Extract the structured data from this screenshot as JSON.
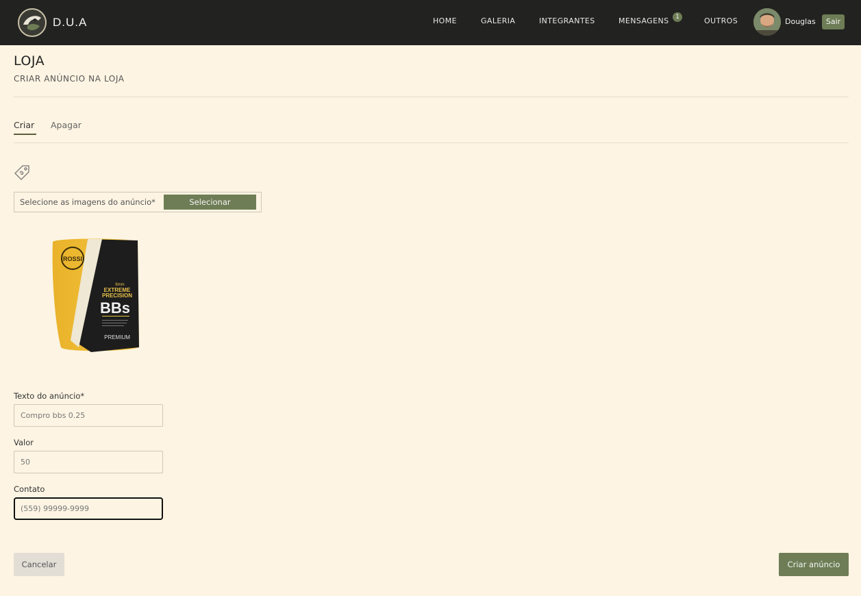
{
  "nav": {
    "brand": "D.U.A",
    "items": [
      {
        "label": "HOME"
      },
      {
        "label": "GALERIA"
      },
      {
        "label": "INTEGRANTES"
      },
      {
        "label": "MENSAGENS"
      },
      {
        "label": "OUTROS"
      }
    ],
    "messages_badge": "1",
    "user_name": "Douglas",
    "logout_label": "Sair"
  },
  "header": {
    "title": "LOJA",
    "subtitle": "CRIAR ANÚNCIO NA LOJA"
  },
  "tabs": [
    {
      "label": "Criar",
      "active": true
    },
    {
      "label": "Apagar",
      "active": false
    }
  ],
  "upload": {
    "label": "Selecione as imagens do anúncio*",
    "button_label": "Selecionar"
  },
  "product_image": {
    "brand_text": "ROSSI",
    "caliber": "6mm",
    "line1": "EXTREME",
    "line2": "PRECISION",
    "big_text": "BBs",
    "grade": "PREMIUM"
  },
  "form": {
    "text_label": "Texto do anúncio*",
    "text_placeholder": "Compro bbs 0.25",
    "value_label": "Valor",
    "value_placeholder": "50",
    "contact_label": "Contato",
    "contact_placeholder": "(559) 99999-9999"
  },
  "actions": {
    "cancel_label": "Cancelar",
    "create_label": "Criar anúncio"
  },
  "colors": {
    "navbar": "#222220",
    "background": "#fdf4e3",
    "accent": "#6e7d55"
  }
}
